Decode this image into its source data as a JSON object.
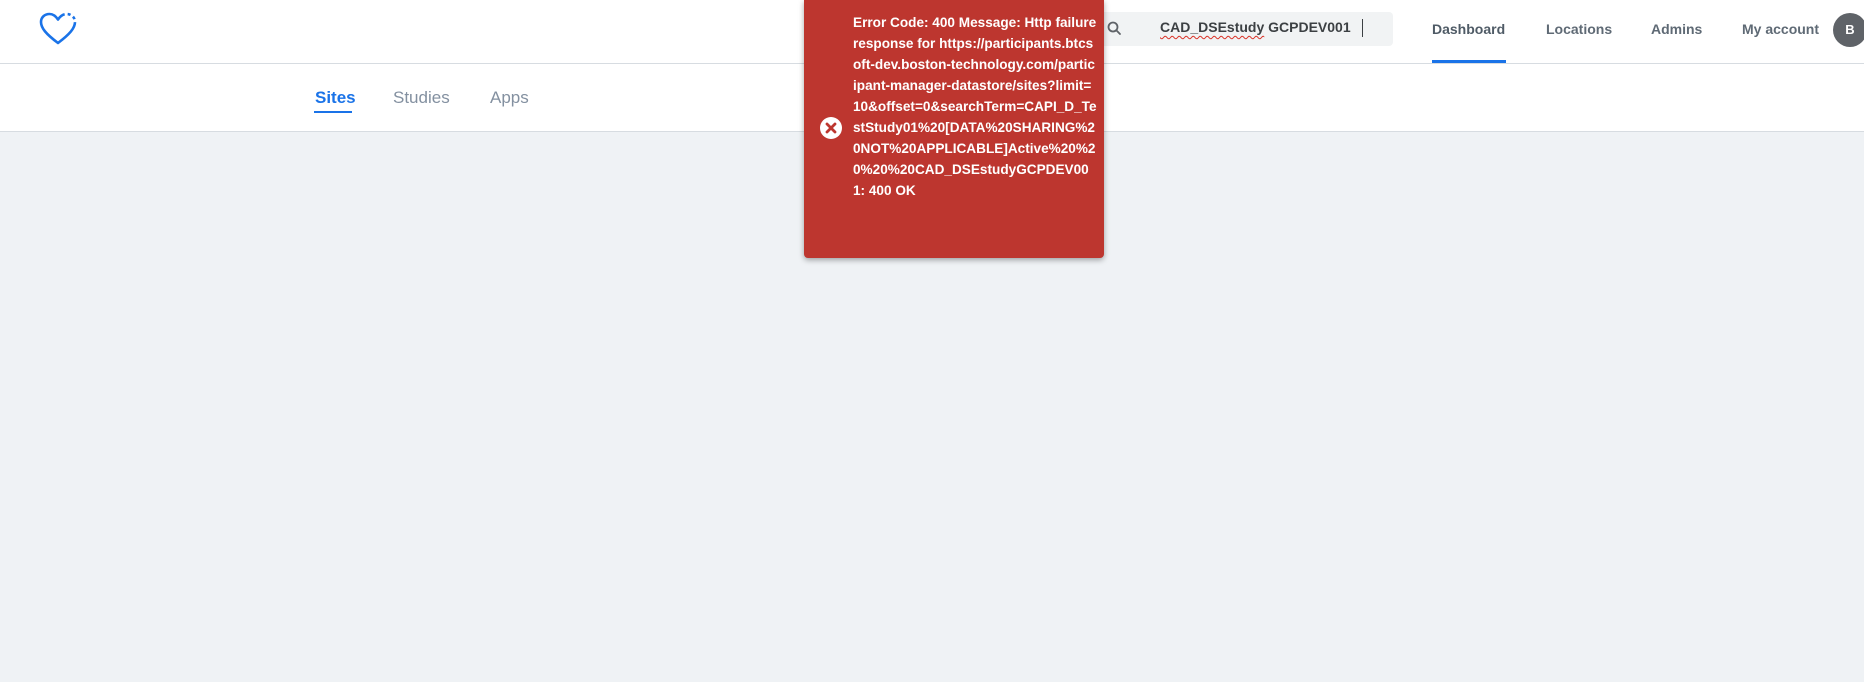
{
  "header": {
    "logo_icon": "heart-outline-icon",
    "search": {
      "icon": "search-icon",
      "value_part1": "CAD_DSEstudy",
      "value_part2": " GCPDEV001"
    },
    "nav": [
      {
        "label": "Dashboard",
        "active": true
      },
      {
        "label": "Locations",
        "active": false
      },
      {
        "label": "Admins",
        "active": false
      },
      {
        "label": "My account",
        "active": false
      }
    ],
    "avatar_initial": "B"
  },
  "subnav": {
    "tabs": [
      {
        "label": "Sites",
        "active": true
      },
      {
        "label": "Studies",
        "active": false
      },
      {
        "label": "Apps",
        "active": false
      }
    ]
  },
  "toast": {
    "icon": "error-close-icon",
    "message": "Error Code: 400 Message: Http failure response for https://participants.btcsoft-dev.boston-technology.com/participant-manager-datastore/sites?limit=10&offset=0&searchTerm=CAPI_D_TestStudy01%20[DATA%20SHARING%20NOT%20APPLICABLE]Active%20%20%20%20CAD_DSEstudyGCPDEV001: 400 OK"
  },
  "colors": {
    "accent": "#1a73e8",
    "error": "#bd362f",
    "background": "#eff2f5"
  }
}
